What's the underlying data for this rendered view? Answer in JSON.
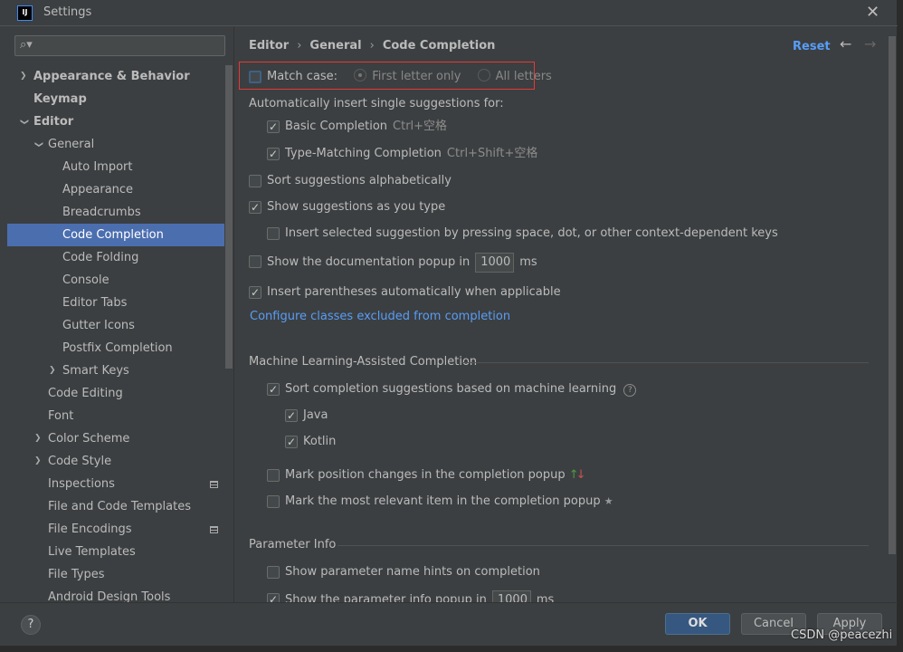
{
  "window": {
    "title": "Settings"
  },
  "sidebar": {
    "search_placeholder": "",
    "items": [
      {
        "label": "Appearance & Behavior",
        "level": 0,
        "bold": true,
        "arrow": "›"
      },
      {
        "label": "Keymap",
        "level": 0,
        "bold": true
      },
      {
        "label": "Editor",
        "level": 0,
        "bold": true,
        "arrow": "⌄"
      },
      {
        "label": "General",
        "level": 1,
        "arrow": "⌄"
      },
      {
        "label": "Auto Import",
        "level": 2
      },
      {
        "label": "Appearance",
        "level": 2
      },
      {
        "label": "Breadcrumbs",
        "level": 2
      },
      {
        "label": "Code Completion",
        "level": 2,
        "selected": true
      },
      {
        "label": "Code Folding",
        "level": 2
      },
      {
        "label": "Console",
        "level": 2
      },
      {
        "label": "Editor Tabs",
        "level": 2
      },
      {
        "label": "Gutter Icons",
        "level": 2
      },
      {
        "label": "Postfix Completion",
        "level": 2
      },
      {
        "label": "Smart Keys",
        "level": 2,
        "arrow": "›"
      },
      {
        "label": "Code Editing",
        "level": 1
      },
      {
        "label": "Font",
        "level": 1
      },
      {
        "label": "Color Scheme",
        "level": 1,
        "arrow": "›"
      },
      {
        "label": "Code Style",
        "level": 1,
        "arrow": "›"
      },
      {
        "label": "Inspections",
        "level": 1,
        "modified": true
      },
      {
        "label": "File and Code Templates",
        "level": 1
      },
      {
        "label": "File Encodings",
        "level": 1,
        "modified": true
      },
      {
        "label": "Live Templates",
        "level": 1
      },
      {
        "label": "File Types",
        "level": 1
      },
      {
        "label": "Android Design Tools",
        "level": 1
      }
    ]
  },
  "breadcrumb": [
    "Editor",
    "General",
    "Code Completion"
  ],
  "header": {
    "reset": "Reset",
    "back_icon": "arrow-left-icon",
    "forward_icon": "arrow-right-icon"
  },
  "match_case": {
    "label": "Match case:",
    "checked": false,
    "options": [
      "First letter only",
      "All letters"
    ],
    "selected": "First letter only"
  },
  "auto_insert": {
    "label": "Automatically insert single suggestions for:",
    "basic": {
      "label": "Basic Completion",
      "shortcut": "Ctrl+空格",
      "checked": true
    },
    "type": {
      "label": "Type-Matching Completion",
      "shortcut": "Ctrl+Shift+空格",
      "checked": true
    }
  },
  "options": {
    "sort_alpha": {
      "label": "Sort suggestions alphabetically",
      "checked": false
    },
    "show_as_type": {
      "label": "Show suggestions as you type",
      "checked": true
    },
    "insert_selected": {
      "label": "Insert selected suggestion by pressing space, dot, or other context-dependent keys",
      "checked": false
    },
    "doc_popup": {
      "label": "Show the documentation popup in",
      "value": "1000",
      "unit": "ms",
      "checked": false
    },
    "parens": {
      "label": "Insert parentheses automatically when applicable",
      "checked": true
    },
    "link": "Configure classes excluded from completion"
  },
  "ml": {
    "title": "Machine Learning-Assisted Completion",
    "sort_ml": {
      "label": "Sort completion suggestions based on machine learning",
      "checked": true
    },
    "java": {
      "label": "Java",
      "checked": true
    },
    "kotlin": {
      "label": "Kotlin",
      "checked": true
    },
    "mark_pos": {
      "label": "Mark position changes in the completion popup",
      "checked": false
    },
    "mark_rel": {
      "label": "Mark the most relevant item in the completion popup",
      "checked": false
    }
  },
  "param": {
    "title": "Parameter Info",
    "hints": {
      "label": "Show parameter name hints on completion",
      "checked": false
    },
    "popup": {
      "label": "Show the parameter info popup in",
      "value": "1000",
      "unit": "ms",
      "checked": true
    }
  },
  "buttons": {
    "ok": "OK",
    "cancel": "Cancel",
    "apply": "Apply",
    "help": "?"
  },
  "watermark": "CSDN @peacezhi",
  "colors": {
    "accent": "#589df6",
    "selection": "#4b6eaf",
    "highlight_box": "#e53935"
  }
}
